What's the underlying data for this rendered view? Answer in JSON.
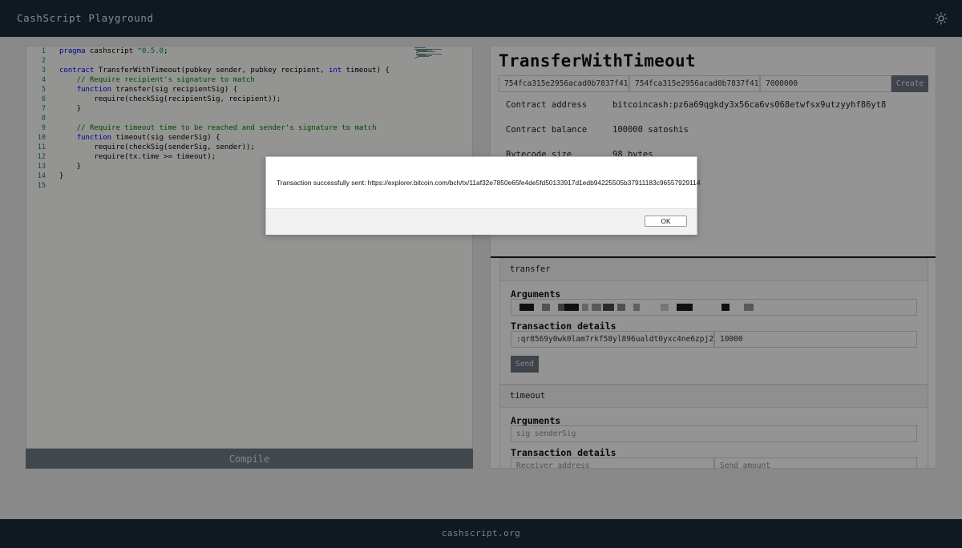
{
  "navbar": {
    "brand": "CashScript Playground",
    "theme_icon": "sun-icon"
  },
  "editor": {
    "lines": [
      {
        "n": "1",
        "segments": [
          {
            "t": "pragma",
            "c": "kw"
          },
          {
            "t": " cashscript ",
            "c": ""
          },
          {
            "t": "^0.5.0",
            "c": "num"
          },
          {
            "t": ";",
            "c": ""
          }
        ]
      },
      {
        "n": "2",
        "segments": []
      },
      {
        "n": "3",
        "segments": [
          {
            "t": "contract",
            "c": "kw"
          },
          {
            "t": " TransferWithTimeout(pubkey sender, pubkey recipient, ",
            "c": ""
          },
          {
            "t": "int",
            "c": "kw"
          },
          {
            "t": " timeout) {",
            "c": ""
          }
        ]
      },
      {
        "n": "4",
        "segments": [
          {
            "t": "    ",
            "c": ""
          },
          {
            "t": "// Require recipient's signature to match",
            "c": "cm"
          }
        ]
      },
      {
        "n": "5",
        "segments": [
          {
            "t": "    ",
            "c": ""
          },
          {
            "t": "function",
            "c": "kw"
          },
          {
            "t": " transfer(sig recipientSig) {",
            "c": ""
          }
        ]
      },
      {
        "n": "6",
        "segments": [
          {
            "t": "        require(checkSig(recipientSig, recipient));",
            "c": ""
          }
        ]
      },
      {
        "n": "7",
        "segments": [
          {
            "t": "    }",
            "c": ""
          }
        ]
      },
      {
        "n": "8",
        "segments": []
      },
      {
        "n": "9",
        "segments": [
          {
            "t": "    ",
            "c": ""
          },
          {
            "t": "// Require timeout time to be reached and sender's signature to match",
            "c": "cm"
          }
        ]
      },
      {
        "n": "10",
        "segments": [
          {
            "t": "    ",
            "c": ""
          },
          {
            "t": "function",
            "c": "kw"
          },
          {
            "t": " timeout(sig senderSig) {",
            "c": ""
          }
        ]
      },
      {
        "n": "11",
        "segments": [
          {
            "t": "        require(checkSig(senderSig, sender));",
            "c": ""
          }
        ]
      },
      {
        "n": "12",
        "segments": [
          {
            "t": "        require(tx.time >= timeout);",
            "c": ""
          }
        ]
      },
      {
        "n": "13",
        "segments": [
          {
            "t": "    }",
            "c": ""
          }
        ]
      },
      {
        "n": "14",
        "segments": [
          {
            "t": "}",
            "c": ""
          }
        ]
      },
      {
        "n": "15",
        "segments": []
      }
    ]
  },
  "compile_label": "Compile",
  "contract": {
    "title": "TransferWithTimeout",
    "inputs": [
      "754fca315e2956acad0b7837f41",
      "754fca315e2956acad0b7837f41",
      "7000000"
    ],
    "create_label": "Create",
    "info": [
      {
        "label": "Contract address",
        "value": "bitcoincash:pz6a69qgkdy3x56ca6vs068etwfsx9utzyyhf86yt8"
      },
      {
        "label": "Contract balance",
        "value": "100000 satoshis"
      },
      {
        "label": "Bytecode size",
        "value": "98 bytes"
      }
    ]
  },
  "functions": {
    "transfer": {
      "name": "transfer",
      "arguments_label": "Arguments",
      "details_label": "Transaction details",
      "receiver": ":qr8569y0wk0lam7rkf58yl896ualdt0yxc4ne6zpj2",
      "amount": "10000",
      "send_label": "Send"
    },
    "timeout": {
      "name": "timeout",
      "arguments_label": "Arguments",
      "arg_placeholder": "sig senderSig",
      "details_label": "Transaction details",
      "receiver_placeholder": "Receiver address",
      "amount_placeholder": "Send amount"
    }
  },
  "dialog": {
    "message": "Transaction successfully sent: https://explorer.bitcoin.com/bch/tx/11af32e7850e65fe4de5fd50133917d1edb94225505b37911183c96557929114",
    "ok_label": "OK"
  },
  "footer": {
    "text": "cashscript.org"
  }
}
